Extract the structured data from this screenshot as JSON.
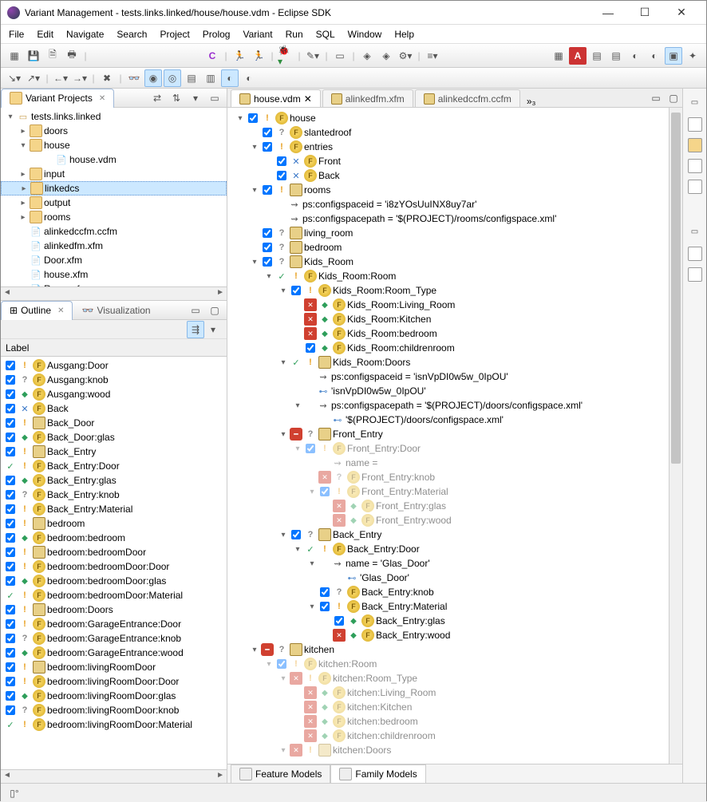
{
  "window": {
    "title": "Variant Management - tests.links.linked/house/house.vdm - Eclipse SDK"
  },
  "menu": [
    "File",
    "Edit",
    "Navigate",
    "Search",
    "Project",
    "Prolog",
    "Variant",
    "Run",
    "SQL",
    "Window",
    "Help"
  ],
  "views": {
    "projects": {
      "tab": "Variant Projects",
      "root": "tests.links.linked",
      "items": [
        {
          "t": "doors",
          "k": "fold",
          "tw": ">"
        },
        {
          "t": "house",
          "k": "fold",
          "tw": "v",
          "open": true,
          "children": [
            {
              "t": "house.vdm",
              "k": "file"
            }
          ]
        },
        {
          "t": "input",
          "k": "fold",
          "tw": ">"
        },
        {
          "t": "linkedcs",
          "k": "fold",
          "tw": ">",
          "sel": true
        },
        {
          "t": "output",
          "k": "fold",
          "tw": ">"
        },
        {
          "t": "rooms",
          "k": "fold",
          "tw": ">"
        },
        {
          "t": "alinkedccfm.ccfm",
          "k": "file"
        },
        {
          "t": "alinkedfm.xfm",
          "k": "file"
        },
        {
          "t": "Door.xfm",
          "k": "file"
        },
        {
          "t": "house.xfm",
          "k": "file"
        },
        {
          "t": "Room.xfm",
          "k": "file"
        }
      ]
    },
    "outline": {
      "tab": "Outline",
      "tab2": "Visualization",
      "header": "Label",
      "rows": [
        {
          "c": true,
          "i": [
            "ex",
            "f"
          ],
          "t": "Ausgang:Door"
        },
        {
          "c": true,
          "i": [
            "q",
            "f"
          ],
          "t": "Ausgang:knob"
        },
        {
          "c": true,
          "i": [
            "diam",
            "f"
          ],
          "t": "Ausgang:wood"
        },
        {
          "c": true,
          "i": [
            "blue",
            "f"
          ],
          "t": "Back"
        },
        {
          "c": true,
          "i": [
            "ex",
            "pkg"
          ],
          "t": "Back_Door"
        },
        {
          "c": true,
          "i": [
            "diam",
            "f"
          ],
          "t": "Back_Door:glas"
        },
        {
          "c": true,
          "i": [
            "ex",
            "pkg"
          ],
          "t": "Back_Entry"
        },
        {
          "c": false,
          "chk": true,
          "i": [
            "ex",
            "f"
          ],
          "t": "Back_Entry:Door"
        },
        {
          "c": true,
          "i": [
            "diam",
            "f"
          ],
          "t": "Back_Entry:glas"
        },
        {
          "c": true,
          "i": [
            "q",
            "f"
          ],
          "t": "Back_Entry:knob"
        },
        {
          "c": true,
          "i": [
            "ex",
            "f"
          ],
          "t": "Back_Entry:Material"
        },
        {
          "c": true,
          "i": [
            "ex",
            "pkg"
          ],
          "t": "bedroom"
        },
        {
          "c": true,
          "i": [
            "diam",
            "f"
          ],
          "t": "bedroom:bedroom"
        },
        {
          "c": true,
          "i": [
            "ex",
            "pkg"
          ],
          "t": "bedroom:bedroomDoor"
        },
        {
          "c": true,
          "i": [
            "ex",
            "f"
          ],
          "t": "bedroom:bedroomDoor:Door"
        },
        {
          "c": true,
          "i": [
            "diam",
            "f"
          ],
          "t": "bedroom:bedroomDoor:glas"
        },
        {
          "c": false,
          "chk": true,
          "i": [
            "ex",
            "f"
          ],
          "t": "bedroom:bedroomDoor:Material"
        },
        {
          "c": true,
          "i": [
            "ex",
            "foldg"
          ],
          "t": "bedroom:Doors"
        },
        {
          "c": true,
          "i": [
            "ex",
            "f"
          ],
          "t": "bedroom:GarageEntrance:Door"
        },
        {
          "c": true,
          "i": [
            "q",
            "f"
          ],
          "t": "bedroom:GarageEntrance:knob"
        },
        {
          "c": true,
          "i": [
            "diam",
            "f"
          ],
          "t": "bedroom:GarageEntrance:wood"
        },
        {
          "c": true,
          "i": [
            "ex",
            "pkg"
          ],
          "t": "bedroom:livingRoomDoor"
        },
        {
          "c": true,
          "i": [
            "ex",
            "f"
          ],
          "t": "bedroom:livingRoomDoor:Door"
        },
        {
          "c": true,
          "i": [
            "diam",
            "f"
          ],
          "t": "bedroom:livingRoomDoor:glas"
        },
        {
          "c": true,
          "i": [
            "q",
            "f"
          ],
          "t": "bedroom:livingRoomDoor:knob"
        },
        {
          "c": false,
          "chk": true,
          "i": [
            "ex",
            "f"
          ],
          "t": "bedroom:livingRoomDoor:Material"
        }
      ]
    }
  },
  "editor": {
    "tabs": [
      {
        "label": "house.vdm",
        "active": true
      },
      {
        "label": "alinkedfm.xfm"
      },
      {
        "label": "alinkedccfm.ccfm"
      }
    ],
    "more": "»₃",
    "bottom_tabs": [
      "Feature Models",
      "Family Models"
    ],
    "tree": [
      {
        "d": 0,
        "tw": "v",
        "c": true,
        "i": [
          "ex",
          "f"
        ],
        "t": "house"
      },
      {
        "d": 1,
        "tw": "",
        "c": true,
        "i": [
          "q",
          "f"
        ],
        "t": "slantedroof"
      },
      {
        "d": 1,
        "tw": "v",
        "c": true,
        "i": [
          "ex",
          "f"
        ],
        "t": "entries"
      },
      {
        "d": 2,
        "tw": "",
        "c": true,
        "i": [
          "blue",
          "f"
        ],
        "t": "Front"
      },
      {
        "d": 2,
        "tw": "",
        "c": true,
        "i": [
          "blue",
          "f"
        ],
        "t": "Back"
      },
      {
        "d": 1,
        "tw": "v",
        "c": true,
        "i": [
          "ex",
          "foldg"
        ],
        "t": "rooms"
      },
      {
        "d": 2,
        "tw": "",
        "i": [
          "attr"
        ],
        "t": "ps:configspaceid = 'i8zYOsUuINX8uy7ar'"
      },
      {
        "d": 2,
        "tw": "",
        "i": [
          "attr"
        ],
        "t": "ps:configspacepath = '$(PROJECT)/rooms/configspace.xml'"
      },
      {
        "d": 1,
        "tw": "",
        "c": true,
        "i": [
          "q",
          "pkg"
        ],
        "t": "living_room"
      },
      {
        "d": 1,
        "tw": "",
        "c": true,
        "i": [
          "q",
          "pkg"
        ],
        "t": "bedroom"
      },
      {
        "d": 1,
        "tw": "v",
        "c": true,
        "i": [
          "q",
          "pkg"
        ],
        "t": "Kids_Room"
      },
      {
        "d": 2,
        "tw": "v",
        "chk": true,
        "i": [
          "ex",
          "f"
        ],
        "t": "Kids_Room:Room"
      },
      {
        "d": 3,
        "tw": "v",
        "c": true,
        "i": [
          "ex",
          "f"
        ],
        "t": "Kids_Room:Room_Type"
      },
      {
        "d": 4,
        "tw": "",
        "x": true,
        "i": [
          "diam",
          "f"
        ],
        "t": "Kids_Room:Living_Room"
      },
      {
        "d": 4,
        "tw": "",
        "x": true,
        "i": [
          "diam",
          "f"
        ],
        "t": "Kids_Room:Kitchen"
      },
      {
        "d": 4,
        "tw": "",
        "x": true,
        "i": [
          "diam",
          "f"
        ],
        "t": "Kids_Room:bedroom"
      },
      {
        "d": 4,
        "tw": "",
        "c": true,
        "i": [
          "diam",
          "f"
        ],
        "t": "Kids_Room:childrenroom"
      },
      {
        "d": 3,
        "tw": "v",
        "chk": true,
        "i": [
          "ex",
          "foldg"
        ],
        "t": "Kids_Room:Doors"
      },
      {
        "d": 4,
        "tw": "",
        "i": [
          "attr"
        ],
        "t": "ps:configspaceid = 'isnVpDI0w5w_0IpOU'"
      },
      {
        "d": 4,
        "tw": "",
        "i": [
          "leaf"
        ],
        "t": "'isnVpDI0w5w_0IpOU'"
      },
      {
        "d": 4,
        "tw": "v",
        "i": [
          "attr"
        ],
        "t": "ps:configspacepath = '$(PROJECT)/doors/configspace.xml'"
      },
      {
        "d": 5,
        "tw": "",
        "i": [
          "leaf"
        ],
        "t": "'$(PROJECT)/doors/configspace.xml'"
      },
      {
        "d": 3,
        "tw": "v",
        "stop": true,
        "i": [
          "q",
          "pkg"
        ],
        "t": "Front_Entry"
      },
      {
        "d": 4,
        "tw": "v",
        "dim": true,
        "c": true,
        "i": [
          "ex",
          "f"
        ],
        "t": "Front_Entry:Door"
      },
      {
        "d": 5,
        "tw": "",
        "dim": true,
        "i": [
          "attr"
        ],
        "t": "name ="
      },
      {
        "d": 5,
        "tw": "",
        "dim": true,
        "x": true,
        "i": [
          "q",
          "f"
        ],
        "t": "Front_Entry:knob"
      },
      {
        "d": 5,
        "tw": "v",
        "dim": true,
        "c": true,
        "i": [
          "ex",
          "f"
        ],
        "t": "Front_Entry:Material"
      },
      {
        "d": 6,
        "tw": "",
        "dim": true,
        "x": true,
        "i": [
          "diam",
          "f"
        ],
        "t": "Front_Entry:glas"
      },
      {
        "d": 6,
        "tw": "",
        "dim": true,
        "x": true,
        "i": [
          "diam",
          "f"
        ],
        "t": "Front_Entry:wood"
      },
      {
        "d": 3,
        "tw": "v",
        "c": true,
        "i": [
          "q",
          "pkg"
        ],
        "t": "Back_Entry"
      },
      {
        "d": 4,
        "tw": "v",
        "chk": true,
        "i": [
          "ex",
          "f"
        ],
        "t": "Back_Entry:Door"
      },
      {
        "d": 5,
        "tw": "v",
        "i": [
          "attr"
        ],
        "t": "name = 'Glas_Door'"
      },
      {
        "d": 6,
        "tw": "",
        "i": [
          "leaf"
        ],
        "t": "'Glas_Door'"
      },
      {
        "d": 5,
        "tw": "",
        "c": true,
        "i": [
          "q",
          "f"
        ],
        "t": "Back_Entry:knob"
      },
      {
        "d": 5,
        "tw": "v",
        "c": true,
        "i": [
          "ex",
          "f"
        ],
        "t": "Back_Entry:Material"
      },
      {
        "d": 6,
        "tw": "",
        "c": true,
        "i": [
          "diam",
          "f"
        ],
        "t": "Back_Entry:glas"
      },
      {
        "d": 6,
        "tw": "",
        "x": true,
        "i": [
          "diam",
          "f"
        ],
        "t": "Back_Entry:wood"
      },
      {
        "d": 1,
        "tw": "v",
        "stop": true,
        "i": [
          "q",
          "pkg"
        ],
        "t": "kitchen"
      },
      {
        "d": 2,
        "tw": "v",
        "dim": true,
        "c": true,
        "i": [
          "ex",
          "f"
        ],
        "t": "kitchen:Room"
      },
      {
        "d": 3,
        "tw": "v",
        "dim": true,
        "x": true,
        "i": [
          "ex",
          "f"
        ],
        "t": "kitchen:Room_Type"
      },
      {
        "d": 4,
        "tw": "",
        "dim": true,
        "x": true,
        "i": [
          "diam",
          "f"
        ],
        "t": "kitchen:Living_Room"
      },
      {
        "d": 4,
        "tw": "",
        "dim": true,
        "x": true,
        "i": [
          "diam",
          "f"
        ],
        "t": "kitchen:Kitchen"
      },
      {
        "d": 4,
        "tw": "",
        "dim": true,
        "x": true,
        "i": [
          "diam",
          "f"
        ],
        "t": "kitchen:bedroom"
      },
      {
        "d": 4,
        "tw": "",
        "dim": true,
        "x": true,
        "i": [
          "diam",
          "f"
        ],
        "t": "kitchen:childrenroom"
      },
      {
        "d": 3,
        "tw": "v",
        "dim": true,
        "x": true,
        "i": [
          "ex",
          "foldg"
        ],
        "t": "kitchen:Doors"
      }
    ]
  }
}
